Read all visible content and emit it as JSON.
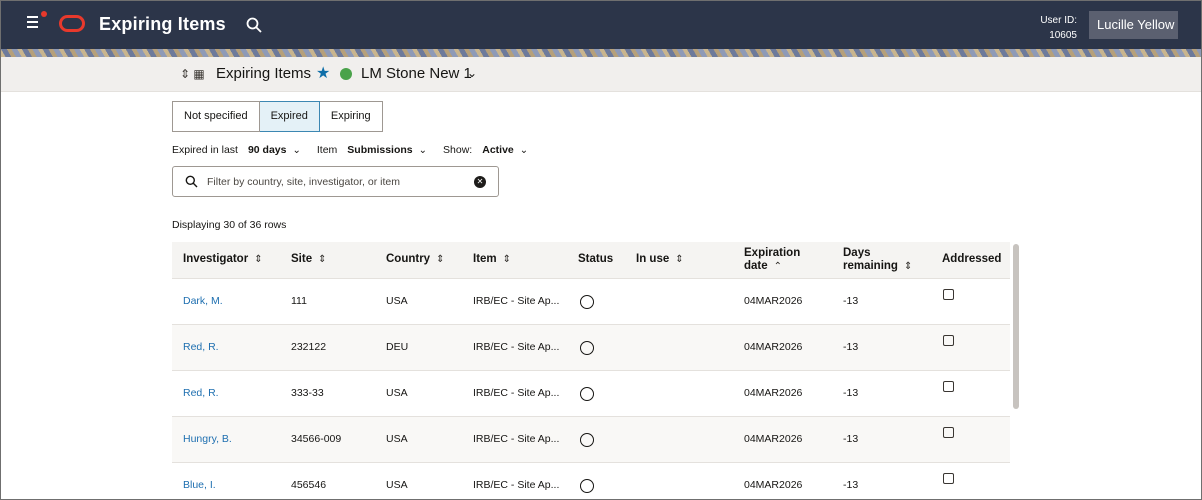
{
  "header": {
    "app_title": "Expiring Items",
    "user_id_label": "User ID:",
    "user_id_value": "10605",
    "user_name": "Lucille Yellow"
  },
  "subheader": {
    "page_title": "Expiring Items",
    "study_name": "LM Stone New 1"
  },
  "segments": [
    "Not specified",
    "Expired",
    "Expiring"
  ],
  "active_segment": "Expired",
  "filters": {
    "expired_label": "Expired in last",
    "expired_value": "90 days",
    "item_label": "Item",
    "item_value": "Submissions",
    "show_label": "Show:",
    "show_value": "Active"
  },
  "search": {
    "placeholder": "Filter by country, site, investigator, or item"
  },
  "row_count": "Displaying 30 of 36 rows",
  "table": {
    "columns": [
      "Investigator",
      "Site",
      "Country",
      "Item",
      "Status",
      "In use",
      "Expiration date",
      "Days remaining",
      "Addressed"
    ],
    "rows": [
      {
        "investigator": "Dark, M.",
        "site": "111",
        "country": "USA",
        "item": "IRB/EC - Site Ap...",
        "expiration": "04MAR2026",
        "days": "-13"
      },
      {
        "investigator": "Red, R.",
        "site": "232122",
        "country": "DEU",
        "item": "IRB/EC - Site Ap...",
        "expiration": "04MAR2026",
        "days": "-13"
      },
      {
        "investigator": "Red, R.",
        "site": "333-33",
        "country": "USA",
        "item": "IRB/EC - Site Ap...",
        "expiration": "04MAR2026",
        "days": "-13"
      },
      {
        "investigator": "Hungry, B.",
        "site": "34566-009",
        "country": "USA",
        "item": "IRB/EC - Site Ap...",
        "expiration": "04MAR2026",
        "days": "-13"
      },
      {
        "investigator": "Blue, I.",
        "site": "456546",
        "country": "USA",
        "item": "IRB/EC - Site Ap...",
        "expiration": "04MAR2026",
        "days": "-13"
      }
    ]
  },
  "colors": {
    "topbar": "#2c3549",
    "brand_red": "#e8392c",
    "link": "#1e6fb0",
    "status_green": "#4aa24a"
  }
}
